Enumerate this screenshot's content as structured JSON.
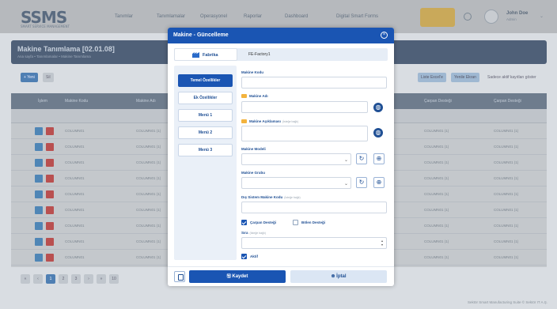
{
  "brand": {
    "logo": "SSMS",
    "tagline": "SMART SERVICE MANAGEMENT"
  },
  "nav": {
    "items": [
      "Tanımlar",
      "Tanımlamalar",
      "Operasyonel",
      "Raporlar",
      "Dashboard",
      "Digital Smart Forms"
    ],
    "user_name": "John Doe",
    "user_role": "Admin"
  },
  "page": {
    "title": "Makine Tanımlama [02.01.08]",
    "breadcrumb": "Ana sayfa • Tanımlamalar • Makine Tanımlama"
  },
  "toolbar": {
    "new": "+ Yeni",
    "delete": "Sil",
    "excel": "Liste Excel'e",
    "refresh": "Yenile Ekran",
    "toggle": "Sadece aktif kayıtları göster"
  },
  "grid": {
    "columns": [
      "İşlem",
      "Makine Kodu",
      "Makine Adı",
      "",
      "Çarpan Desteği",
      "Çarpan Desteği"
    ],
    "rows": [
      {
        "code": "COLUMN01",
        "name": "COLUMN01 (1)",
        "c5": "COLUMN01 (1)",
        "c6": "COLUMN01 (1)"
      },
      {
        "code": "COLUMN01",
        "name": "COLUMN01 (1)",
        "c5": "COLUMN01 (1)",
        "c6": "COLUMN01 (1)"
      },
      {
        "code": "COLUMN01",
        "name": "COLUMN01 (1)",
        "c5": "COLUMN01 (1)",
        "c6": "COLUMN01 (1)"
      },
      {
        "code": "COLUMN01",
        "name": "COLUMN01 (1)",
        "c5": "COLUMN01 (1)",
        "c6": "COLUMN01 (1)"
      },
      {
        "code": "COLUMN01",
        "name": "COLUMN01 (1)",
        "c5": "COLUMN01 (1)",
        "c6": "COLUMN01 (1)"
      },
      {
        "code": "COLUMN01",
        "name": "COLUMN01 (1)",
        "c5": "COLUMN01 (1)",
        "c6": "COLUMN01 (1)"
      },
      {
        "code": "COLUMN01",
        "name": "COLUMN01 (1)",
        "c5": "COLUMN01 (1)",
        "c6": "COLUMN01 (1)"
      },
      {
        "code": "COLUMN01",
        "name": "COLUMN01 (1)",
        "c5": "COLUMN01 (1)",
        "c6": "COLUMN01 (1)"
      },
      {
        "code": "COLUMN01",
        "name": "COLUMN01 (1)",
        "c5": "COLUMN01 (1)",
        "c6": "COLUMN01 (1)"
      }
    ]
  },
  "pager": {
    "pages": [
      "«",
      "‹",
      "1",
      "2",
      "3",
      "›",
      "»",
      "10"
    ]
  },
  "footer": "Sektör Smart Manufacturing Suite © Sektör IT A.Ş.",
  "modal": {
    "title": "Makine - Güncelleme",
    "tab_label": "Fabrika",
    "tab_value": "FE-Factory1",
    "side": [
      "Temel Özellikler",
      "Ek Özellikler",
      "Menü 1",
      "Menü 2",
      "Menü 3"
    ],
    "fields": {
      "code": "Makine Kodu",
      "name": "Makine Adı",
      "desc": "Makine Açıklaması",
      "desc_hint": "(İsteğe bağlı)",
      "model": "Makine Modeli",
      "group": "Makine Grubu",
      "ext": "Dış Sistem Makine Kodu",
      "ext_hint": "(İsteğe bağlı)",
      "carpan": "Çarpan Desteği",
      "bolen": "Bölen Desteği",
      "sira": "Sıra",
      "sira_hint": "(İsteğe bağlı)",
      "aktif": "Aktif"
    },
    "save": "Kaydet",
    "cancel": "İptal",
    "colors": {
      "primary": "#1a55b3"
    }
  }
}
